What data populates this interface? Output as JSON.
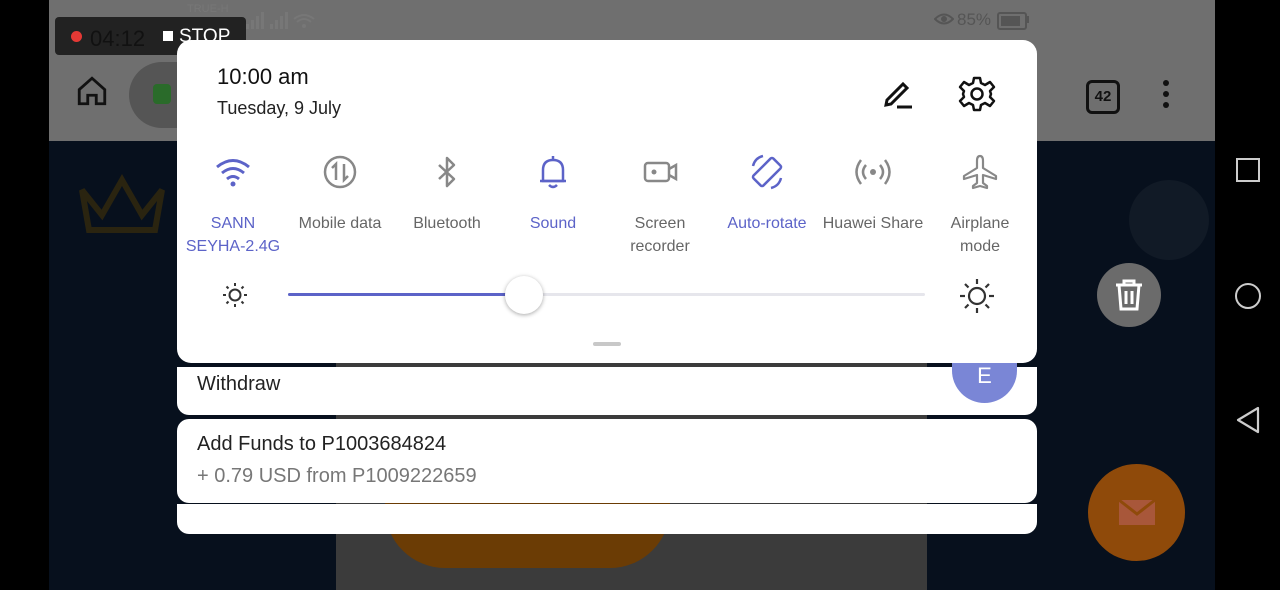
{
  "status_bar": {
    "carrier": "TRUE-H",
    "battery": "85%"
  },
  "recorder": {
    "elapsed": "04:12",
    "stop_label": "STOP"
  },
  "browser": {
    "tab_count": "42"
  },
  "quick_panel": {
    "time": "10:00 am",
    "date": "Tuesday, 9 July",
    "tiles": [
      {
        "line1": "SANN",
        "line2": "SEYHA-2.4G",
        "icon": "wifi-icon",
        "active": true
      },
      {
        "line1": "Mobile data",
        "line2": "",
        "icon": "mobile-data-icon",
        "active": false
      },
      {
        "line1": "Bluetooth",
        "line2": "",
        "icon": "bluetooth-icon",
        "active": false
      },
      {
        "line1": "Sound",
        "line2": "",
        "icon": "bell-icon",
        "active": true
      },
      {
        "line1": "Screen",
        "line2": "recorder",
        "icon": "screen-recorder-icon",
        "active": false
      },
      {
        "line1": "Auto-rotate",
        "line2": "",
        "icon": "auto-rotate-icon",
        "active": true
      },
      {
        "line1": "Huawei Share",
        "line2": "",
        "icon": "huawei-share-icon",
        "active": false
      },
      {
        "line1": "Airplane",
        "line2": "mode",
        "icon": "airplane-icon",
        "active": false
      }
    ],
    "brightness": 0.37,
    "accent_color": "#5c63c8"
  },
  "notifications": [
    {
      "title": "Withdraw",
      "avatar_letter": "E"
    },
    {
      "title": "Add Funds to P1003684824",
      "subtitle": "+ 0.79 USD from P1009222659"
    }
  ]
}
